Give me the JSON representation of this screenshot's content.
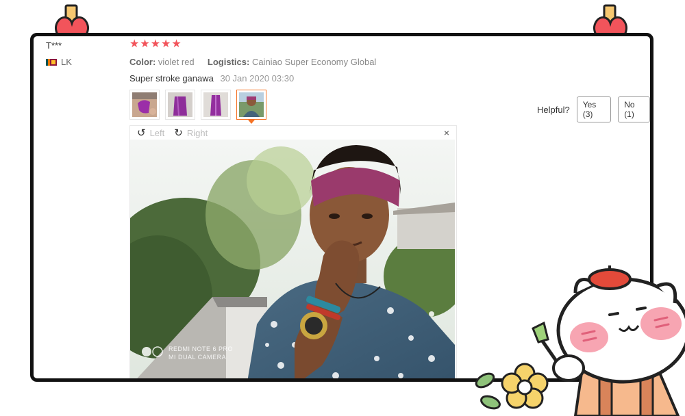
{
  "review": {
    "user_name": "T***",
    "country": "LK",
    "rating": 5,
    "stars": [
      "★",
      "★",
      "★",
      "★",
      "★"
    ],
    "color_label": "Color:",
    "color_value": "violet red",
    "logistics_label": "Logistics:",
    "logistics_value": "Cainiao Super Economy Global",
    "text": "Super stroke ganawa",
    "date": "30 Jan 2020 03:30",
    "thumbnails": [
      {
        "name": "photo-1"
      },
      {
        "name": "photo-2"
      },
      {
        "name": "photo-3"
      },
      {
        "name": "photo-4",
        "active": true
      }
    ]
  },
  "helpful": {
    "label": "Helpful?",
    "yes_label": "Yes (3)",
    "no_label": "No (1)"
  },
  "viewer": {
    "rotate_left_label": "Left",
    "rotate_right_label": "Right",
    "close_label": "×",
    "rotate_left_icon": "↺",
    "rotate_right_icon": "↻",
    "watermark_line1": "REDMI NOTE 6 PRO",
    "watermark_line2": "MI DUAL CAMERA"
  },
  "colors": {
    "star": "#f2545b",
    "accent": "#f57224",
    "heart": "#f2545b"
  }
}
